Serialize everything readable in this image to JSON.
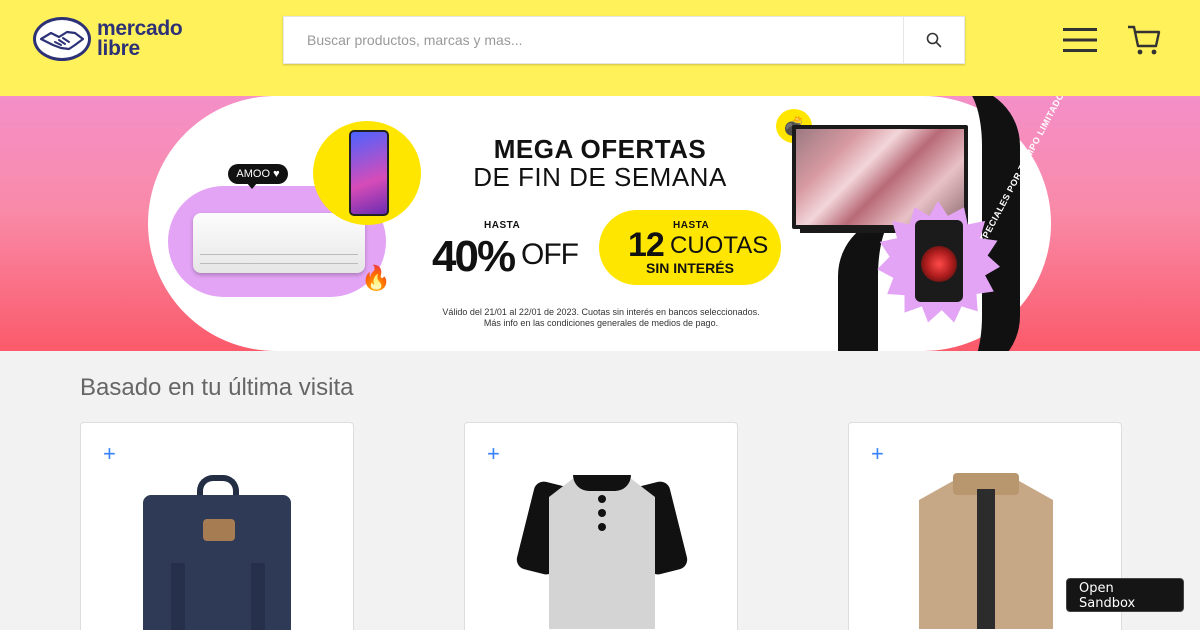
{
  "header": {
    "logo": {
      "line1": "mercado",
      "line2": "libre"
    },
    "search": {
      "placeholder": "Buscar productos, marcas y mas...",
      "value": ""
    },
    "icons": [
      "search-icon",
      "menu-icon",
      "cart-icon"
    ],
    "background": "#fff159"
  },
  "banner": {
    "title_line1": "MEGA OFERTAS",
    "title_line2": "DE FIN DE SEMANA",
    "discount": {
      "prefix": "HASTA",
      "value": "40%",
      "suffix": "OFF"
    },
    "installments": {
      "prefix": "HASTA",
      "number": "12",
      "word": "CUOTAS",
      "note": "SIN INTERÉS"
    },
    "fine_print_1": "Válido del 21/01 al 22/01 de 2023. Cuotas sin interés en bancos seleccionados.",
    "fine_print_2": "Más info en las condiciones generales de medios de pago.",
    "amoo_label": "AMOO",
    "ribbon_text": "ESPECIALES POR TIEMPO LIMITADO",
    "ribbon_text_2": "ESPECIALES POR TIEMPO LIMITADO",
    "colors": {
      "pink": "#f48fc8",
      "red": "#fb5a6a",
      "yellow": "#ffe600",
      "lilac": "#e3a4f5"
    }
  },
  "section": {
    "title": "Basado en tu última visita",
    "cards": [
      {
        "plus": "+",
        "product": "backpack"
      },
      {
        "plus": "+",
        "product": "henley-shirt"
      },
      {
        "plus": "+",
        "product": "jacket"
      }
    ]
  },
  "sandbox": {
    "label": "Open Sandbox"
  }
}
